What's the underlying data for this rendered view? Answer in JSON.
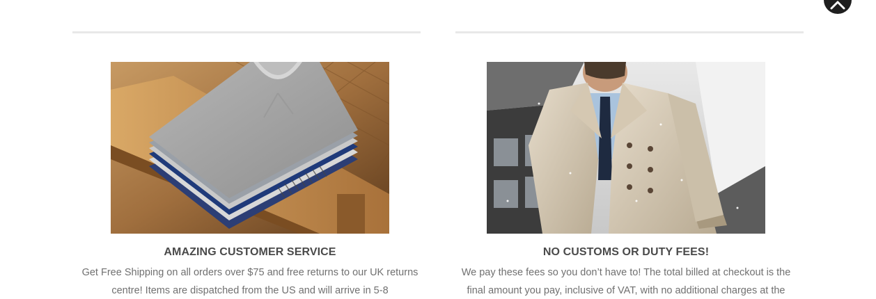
{
  "features": [
    {
      "title": "AMAZING CUSTOMER SERVICE",
      "description": "Get Free Shipping on all orders over $75 and free returns to our UK returns centre! Items are dispatched from the US and will arrive in 5-8"
    },
    {
      "title": "NO CUSTOMS OR DUTY FEES!",
      "description": "We pay these fees so you don’t have to! The total billed at checkout is the final amount you pay, inclusive of VAT, with no additional charges at the"
    }
  ],
  "scroll_top": {
    "icon": "chevron-up-icon"
  }
}
